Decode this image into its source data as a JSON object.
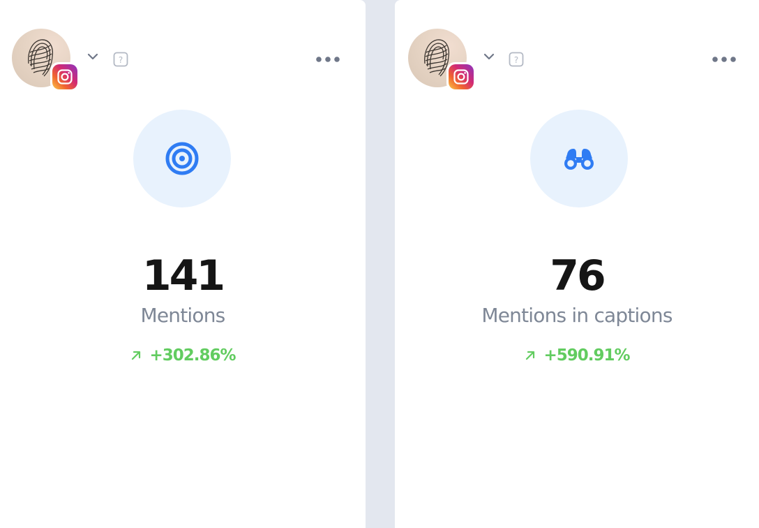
{
  "colors": {
    "accent_blue": "#2f7cf3",
    "icon_bg": "#e8f2fd",
    "positive_green": "#62cc60",
    "label_gray": "#7e8796",
    "value_black": "#151515",
    "divider": "#e3e7ef"
  },
  "cards": [
    {
      "icon": "target-icon",
      "value": "141",
      "label": "Mentions",
      "change": "+302.86%",
      "change_direction": "up"
    },
    {
      "icon": "binoculars-icon",
      "value": "76",
      "label": "Mentions in captions",
      "change": "+590.91%",
      "change_direction": "up"
    }
  ],
  "account": {
    "network_icon": "instagram-icon",
    "help_glyph": "?"
  }
}
